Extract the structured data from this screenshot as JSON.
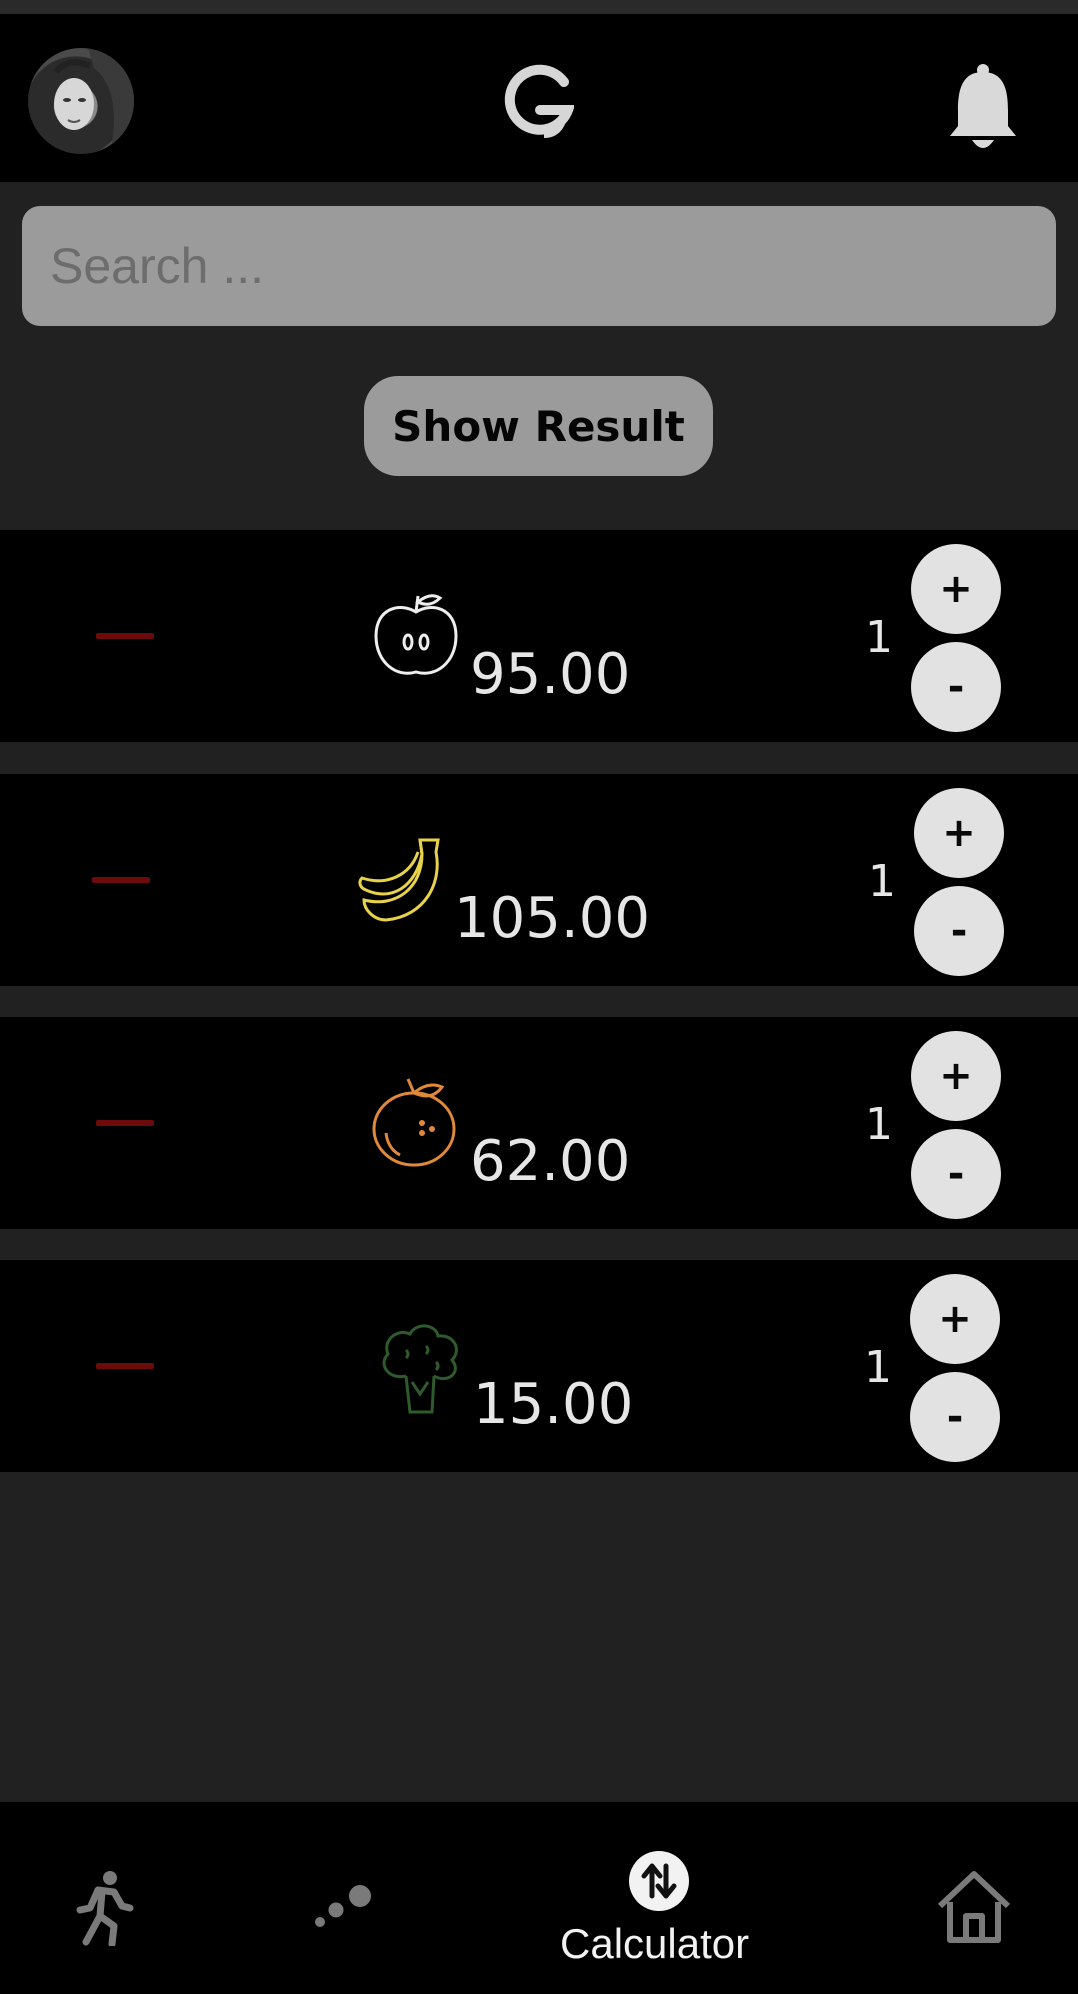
{
  "header": {
    "avatar": "profile-photo",
    "logo": "G",
    "notification_icon": "bell-icon"
  },
  "search": {
    "placeholder": "Search ..."
  },
  "actions": {
    "show_result_label": "Show Result"
  },
  "items": [
    {
      "icon": "apple-icon",
      "price": "95.00",
      "quantity": "1",
      "plus_label": "+",
      "minus_label": "-"
    },
    {
      "icon": "banana-icon",
      "price": "105.00",
      "quantity": "1",
      "plus_label": "+",
      "minus_label": "-"
    },
    {
      "icon": "orange-icon",
      "price": "62.00",
      "quantity": "1",
      "plus_label": "+",
      "minus_label": "-"
    },
    {
      "icon": "broccoli-icon",
      "price": "15.00",
      "quantity": "1",
      "plus_label": "+",
      "minus_label": "-"
    }
  ],
  "bottom_nav": {
    "items": [
      {
        "icon": "running-icon"
      },
      {
        "icon": "dots-icon"
      },
      {
        "icon": "swap-vertical-icon",
        "label": "Calculator",
        "active": true
      },
      {
        "icon": "home-icon"
      }
    ]
  },
  "colors": {
    "background": "#212121",
    "bar": "#000000",
    "search_bg": "#9b9b9b",
    "remove_dash": "#6d0b0b",
    "apple_stroke": "#eeeeee",
    "banana_stroke": "#e8d24a",
    "orange_stroke": "#e0893a",
    "broccoli_stroke": "#2f5a2c"
  }
}
